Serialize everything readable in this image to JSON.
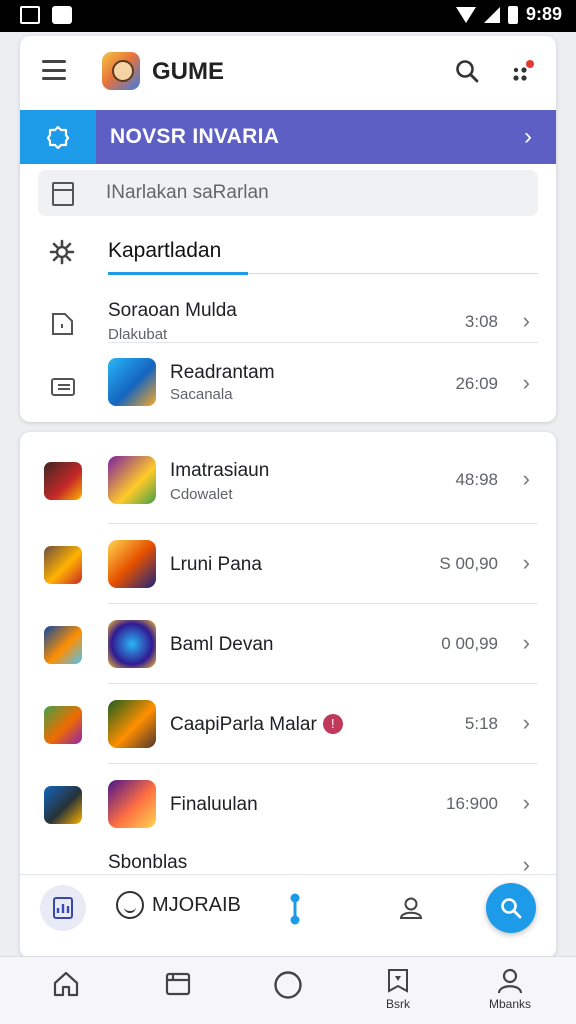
{
  "status_bar": {
    "time": "9:89"
  },
  "header": {
    "app_title": "GUME"
  },
  "banner": {
    "label": "NOVSR INVARIA"
  },
  "search": {
    "placeholder": "INarlakan saRarlan"
  },
  "section": {
    "title": "Kapartladan"
  },
  "top_list": [
    {
      "title": "Soraoan Mulda",
      "subtitle": "Dlakubat",
      "value": "3:08"
    },
    {
      "title": "Readrantam",
      "subtitle": "Sacanala",
      "value": "26:09"
    }
  ],
  "game_list": [
    {
      "title": "Imatrasiaun",
      "subtitle": "Cdowalet",
      "value": "48:98"
    },
    {
      "title": "Lruni Pana",
      "subtitle": "",
      "value": "S 00,90"
    },
    {
      "title": "Baml Devan",
      "subtitle": "",
      "value": "0 00,99"
    },
    {
      "title": "CaapiParla Malar",
      "subtitle": "",
      "value": "5:18",
      "badge": "!"
    },
    {
      "title": "Finaluulan",
      "subtitle": "",
      "value": "16:900"
    },
    {
      "title": "Sbonblas",
      "subtitle": "",
      "value": ""
    }
  ],
  "toolbar": {
    "pill_label": "MJORAIB"
  },
  "nav": {
    "item4_label": "Bsrk",
    "item5_label": "Mbanks"
  },
  "colors": {
    "accent_blue": "#1e9be8",
    "banner_purple": "#5d5fc4"
  }
}
